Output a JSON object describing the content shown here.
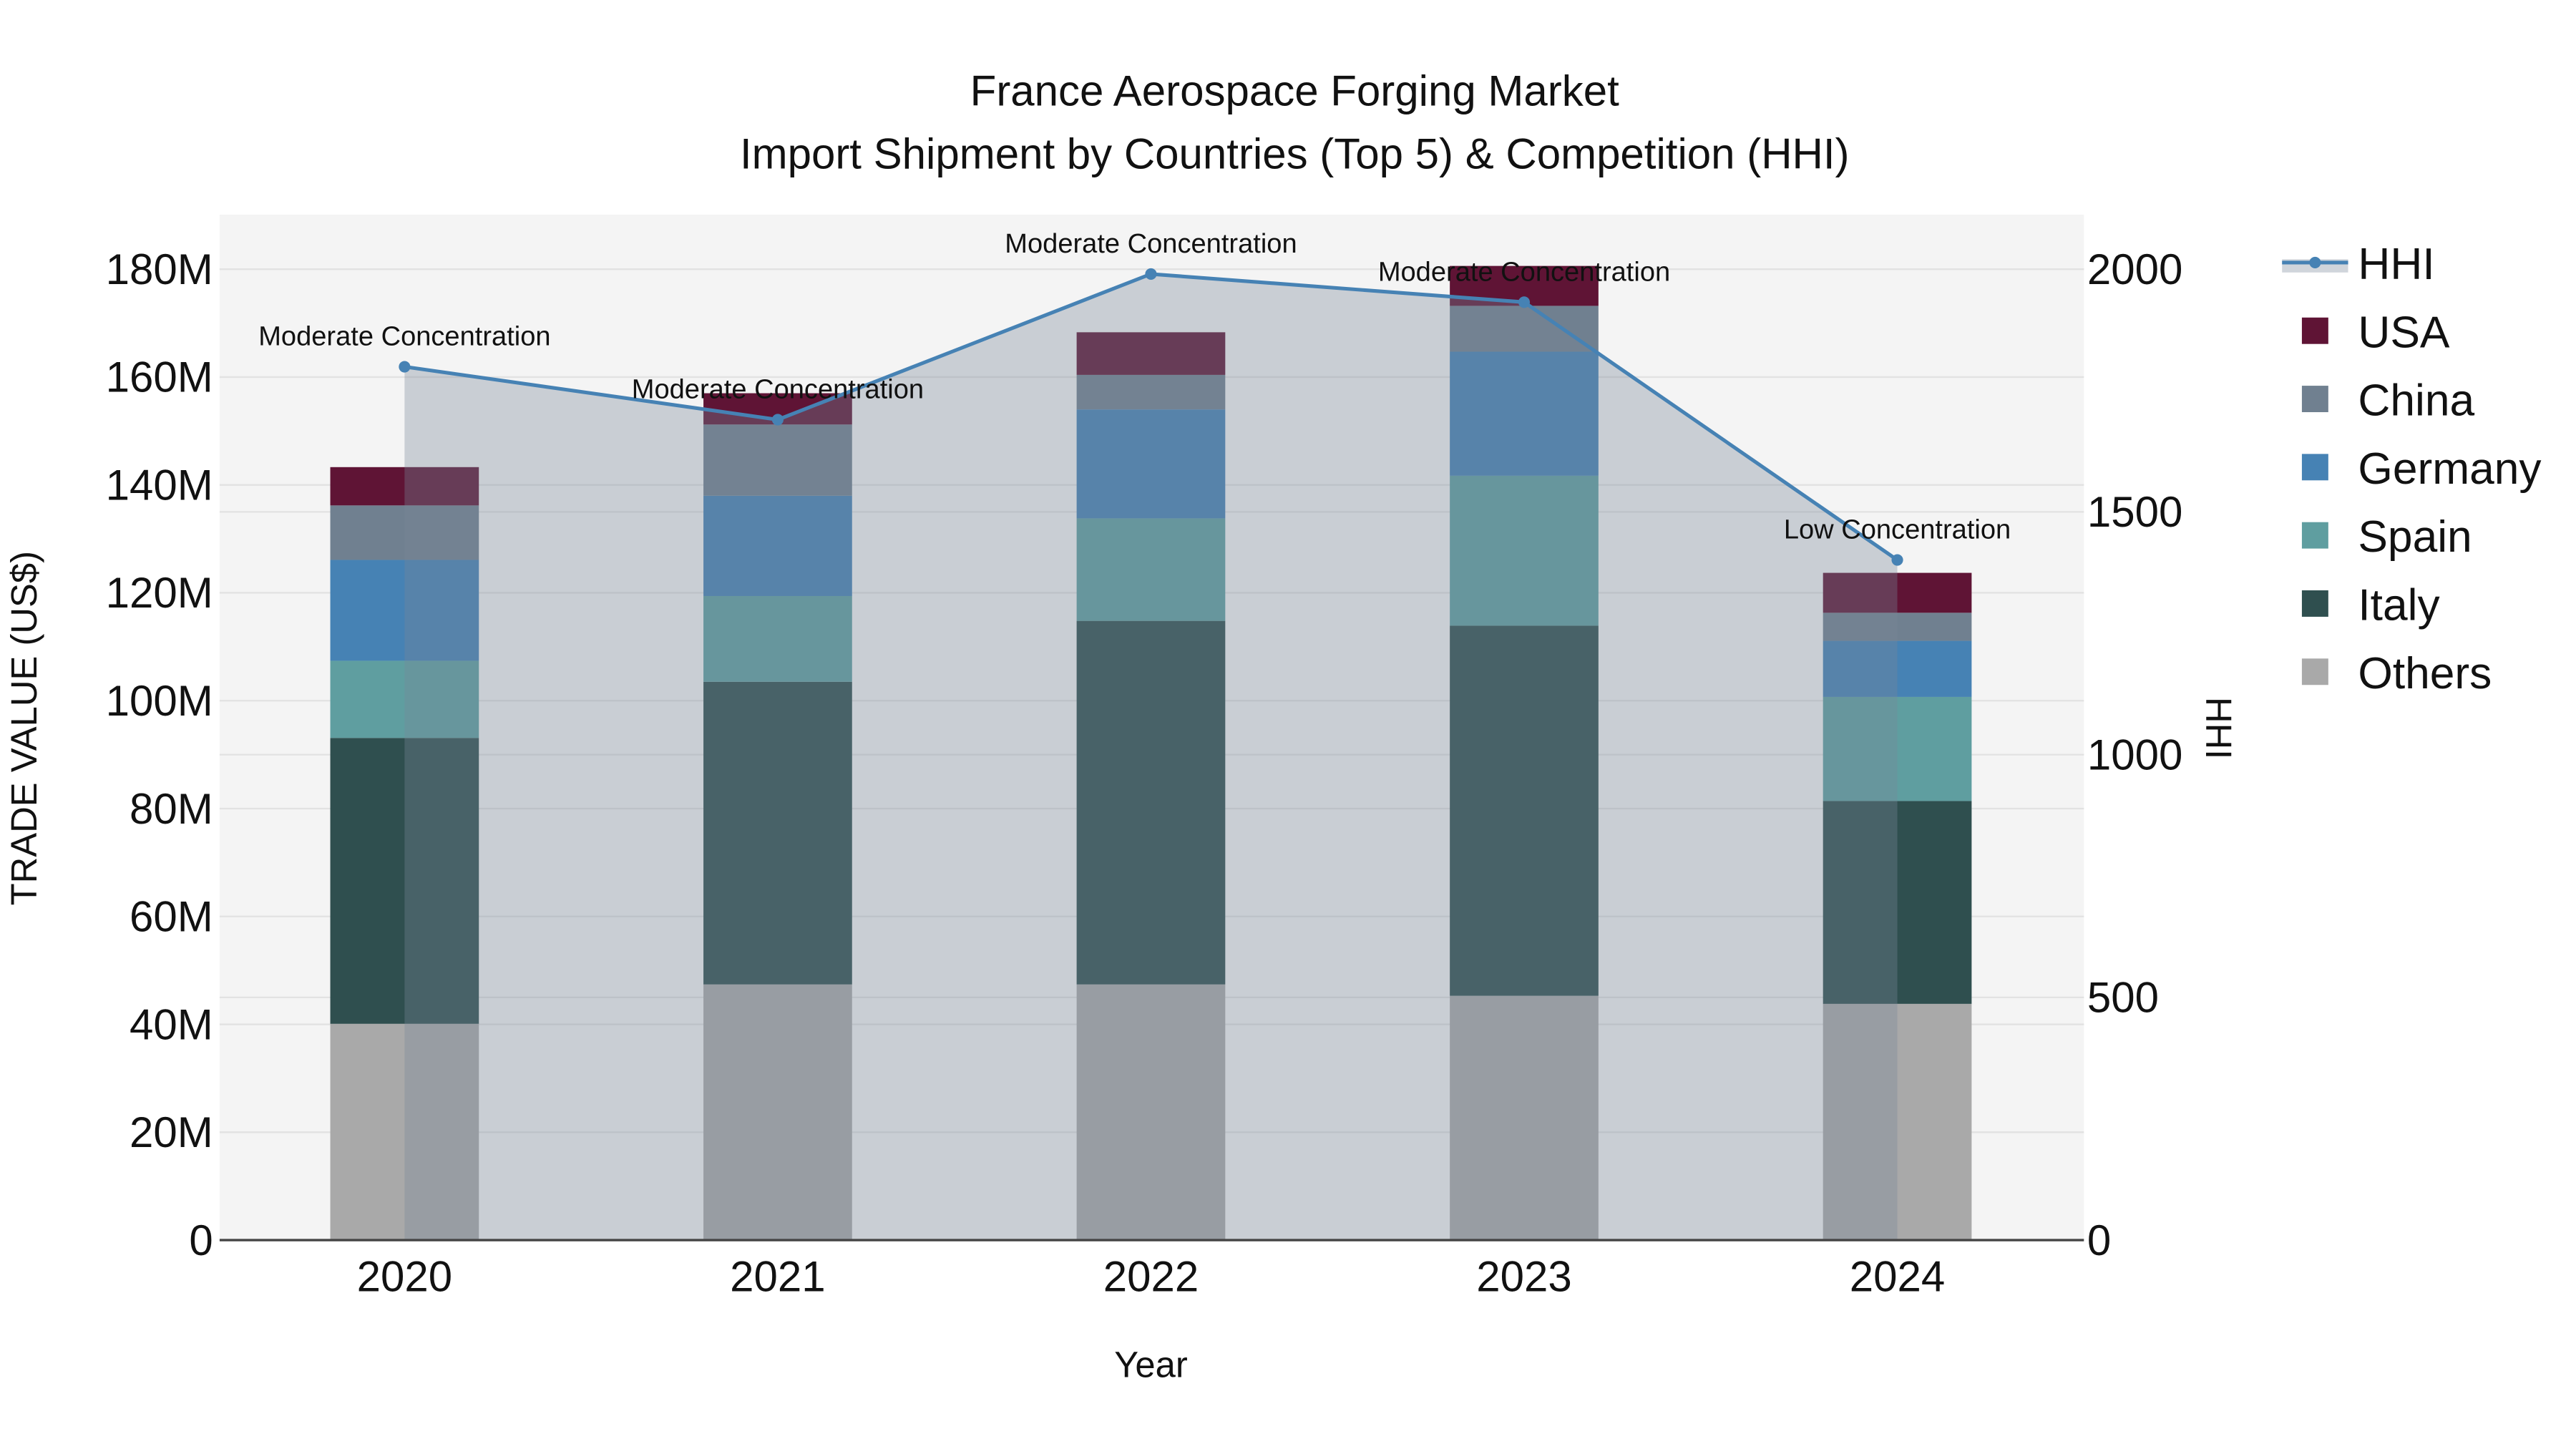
{
  "chart_data": {
    "type": "bar",
    "title_line1": "France Aerospace Forging Market",
    "title_line2": "Import Shipment by Countries (Top 5) & Competition (HHI)",
    "xlabel": "Year",
    "ylabel": "TRADE VALUE (US$)",
    "y2label": "HHI",
    "categories": [
      "2020",
      "2021",
      "2022",
      "2023",
      "2024"
    ],
    "ylim": [
      0,
      190
    ],
    "y_unit": "M US$",
    "yticks": [
      0,
      20,
      40,
      60,
      80,
      100,
      120,
      140,
      160,
      180
    ],
    "ytick_labels": [
      "0",
      "20M",
      "40M",
      "60M",
      "80M",
      "100M",
      "120M",
      "140M",
      "160M",
      "180M"
    ],
    "y2lim": [
      0,
      2111
    ],
    "y2ticks": [
      0,
      500,
      1000,
      1500,
      2000
    ],
    "y2tick_labels": [
      "0",
      "500",
      "1000",
      "1500",
      "2000"
    ],
    "series": [
      {
        "name": "Others",
        "color": "#a9a9a9",
        "values": [
          40.1,
          47.4,
          47.4,
          45.3,
          43.8
        ]
      },
      {
        "name": "Italy",
        "color": "#2f4f4f",
        "values": [
          53.0,
          56.1,
          67.4,
          68.6,
          37.6
        ]
      },
      {
        "name": "Spain",
        "color": "#5f9ea0",
        "values": [
          14.3,
          15.9,
          19.0,
          27.8,
          19.3
        ]
      },
      {
        "name": "Germany",
        "color": "#4682b4",
        "values": [
          18.7,
          18.6,
          20.2,
          23.0,
          10.4
        ]
      },
      {
        "name": "China",
        "color": "#708090",
        "values": [
          10.1,
          13.2,
          6.4,
          8.5,
          5.2
        ]
      },
      {
        "name": "USA",
        "color": "#5f1435",
        "values": [
          7.1,
          5.8,
          7.9,
          7.4,
          7.4
        ]
      }
    ],
    "hhi": {
      "name": "HHI",
      "color": "#4682b4",
      "values": [
        1799,
        1690,
        1990,
        1932,
        1401
      ],
      "annotations": [
        "Moderate Concentration",
        "Moderate Concentration",
        "Moderate Concentration",
        "Moderate Concentration",
        "Low Concentration"
      ]
    },
    "legend": [
      "HHI",
      "USA",
      "China",
      "Germany",
      "Spain",
      "Italy",
      "Others"
    ],
    "legend_position": "right",
    "grid": true
  }
}
